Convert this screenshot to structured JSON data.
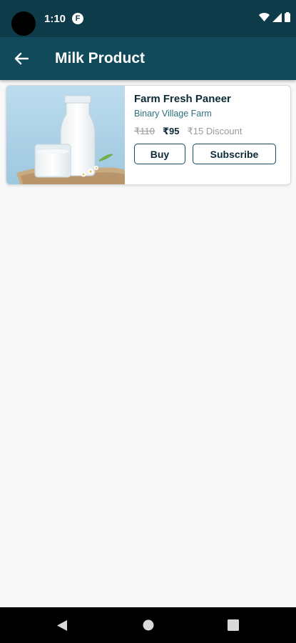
{
  "status_bar": {
    "time": "1:10",
    "notification_icon": "F"
  },
  "app_bar": {
    "title": "Milk Product"
  },
  "products": [
    {
      "name": "Farm Fresh Paneer",
      "farm": "Binary Village Farm",
      "original_price": "₹110",
      "price": "₹95",
      "discount": "₹15 Discount",
      "buy_label": "Buy",
      "subscribe_label": "Subscribe"
    }
  ],
  "colors": {
    "status_bar": "#0e3b4a",
    "app_bar": "#114a5b",
    "accent": "#114a5b",
    "background": "#f8f8f8"
  },
  "icons": [
    "back-arrow-icon",
    "wifi-icon",
    "signal-icon",
    "battery-icon",
    "nav-back-icon",
    "nav-home-icon",
    "nav-recents-icon"
  ]
}
